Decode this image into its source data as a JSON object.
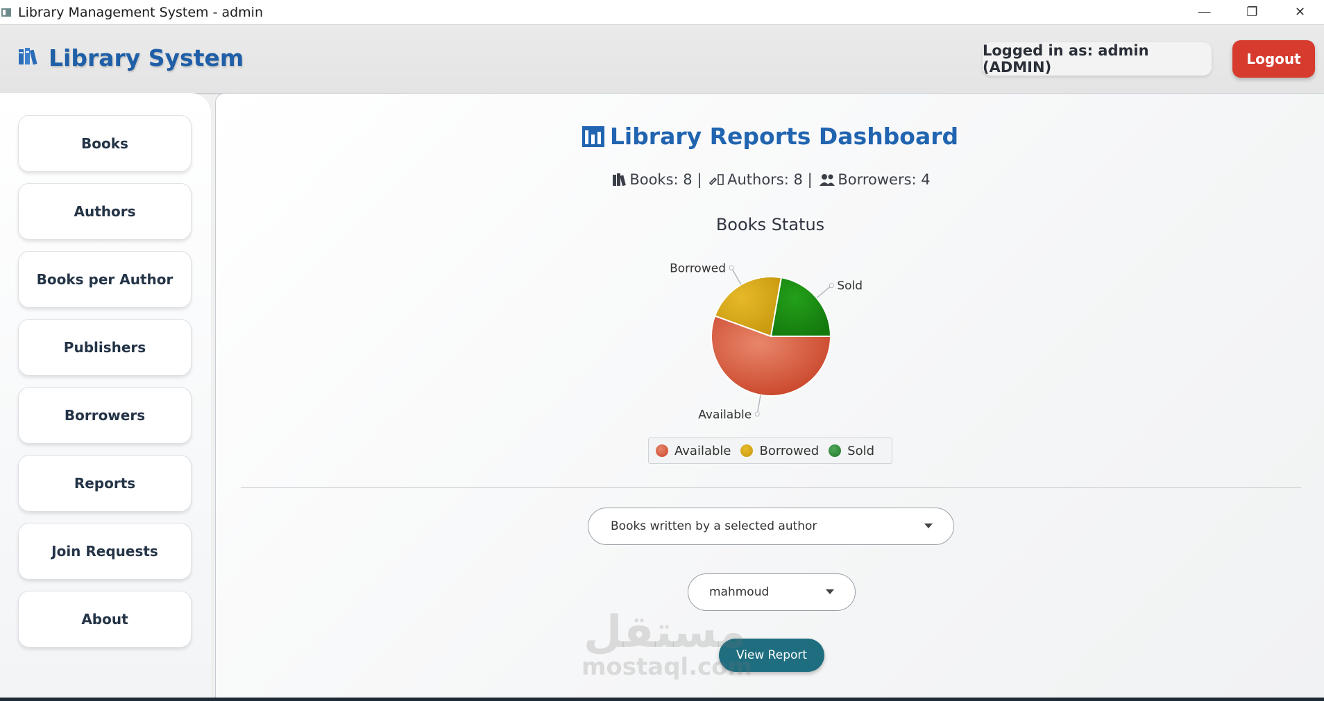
{
  "window": {
    "title": "Library Management System - admin",
    "controls": {
      "minimize": "—",
      "restore": "❐",
      "close": "✕"
    }
  },
  "header": {
    "brand": "Library System",
    "brand_icon": "books-icon",
    "user_label": "Logged in as: admin (ADMIN)",
    "logout_label": "Logout"
  },
  "sidebar": {
    "items": [
      {
        "label": "Books"
      },
      {
        "label": "Authors"
      },
      {
        "label": "Books per Author"
      },
      {
        "label": "Publishers"
      },
      {
        "label": "Borrowers"
      },
      {
        "label": "Reports"
      },
      {
        "label": "Join Requests"
      },
      {
        "label": "About"
      }
    ]
  },
  "main": {
    "title": "Library Reports Dashboard",
    "title_icon": "bar-chart-icon",
    "stats": {
      "books": "Books: 8",
      "authors": "Authors: 8",
      "borrowers": "Borrowers: 4",
      "separator": "|"
    },
    "report_type": "Books written by a selected author",
    "author_selected": "mahmoud",
    "view_label": "View Report",
    "watermark": {
      "arabic": "مستقل",
      "latin": "mostaql.com"
    }
  },
  "colors": {
    "available": "#d95a3c",
    "borrowed": "#d4a617",
    "sold": "#1a8a12",
    "brand": "#1f5fa8",
    "logout": "#d63b2d",
    "view_button": "#1f6e80"
  },
  "chart_data": {
    "type": "pie",
    "title": "Books Status",
    "categories": [
      "Available",
      "Borrowed",
      "Sold"
    ],
    "values": [
      5,
      2,
      2
    ],
    "colors": [
      "#d95a3c",
      "#d4a617",
      "#1a8a12"
    ],
    "legend": [
      "Available",
      "Borrowed",
      "Sold"
    ],
    "legend_position": "bottom"
  }
}
